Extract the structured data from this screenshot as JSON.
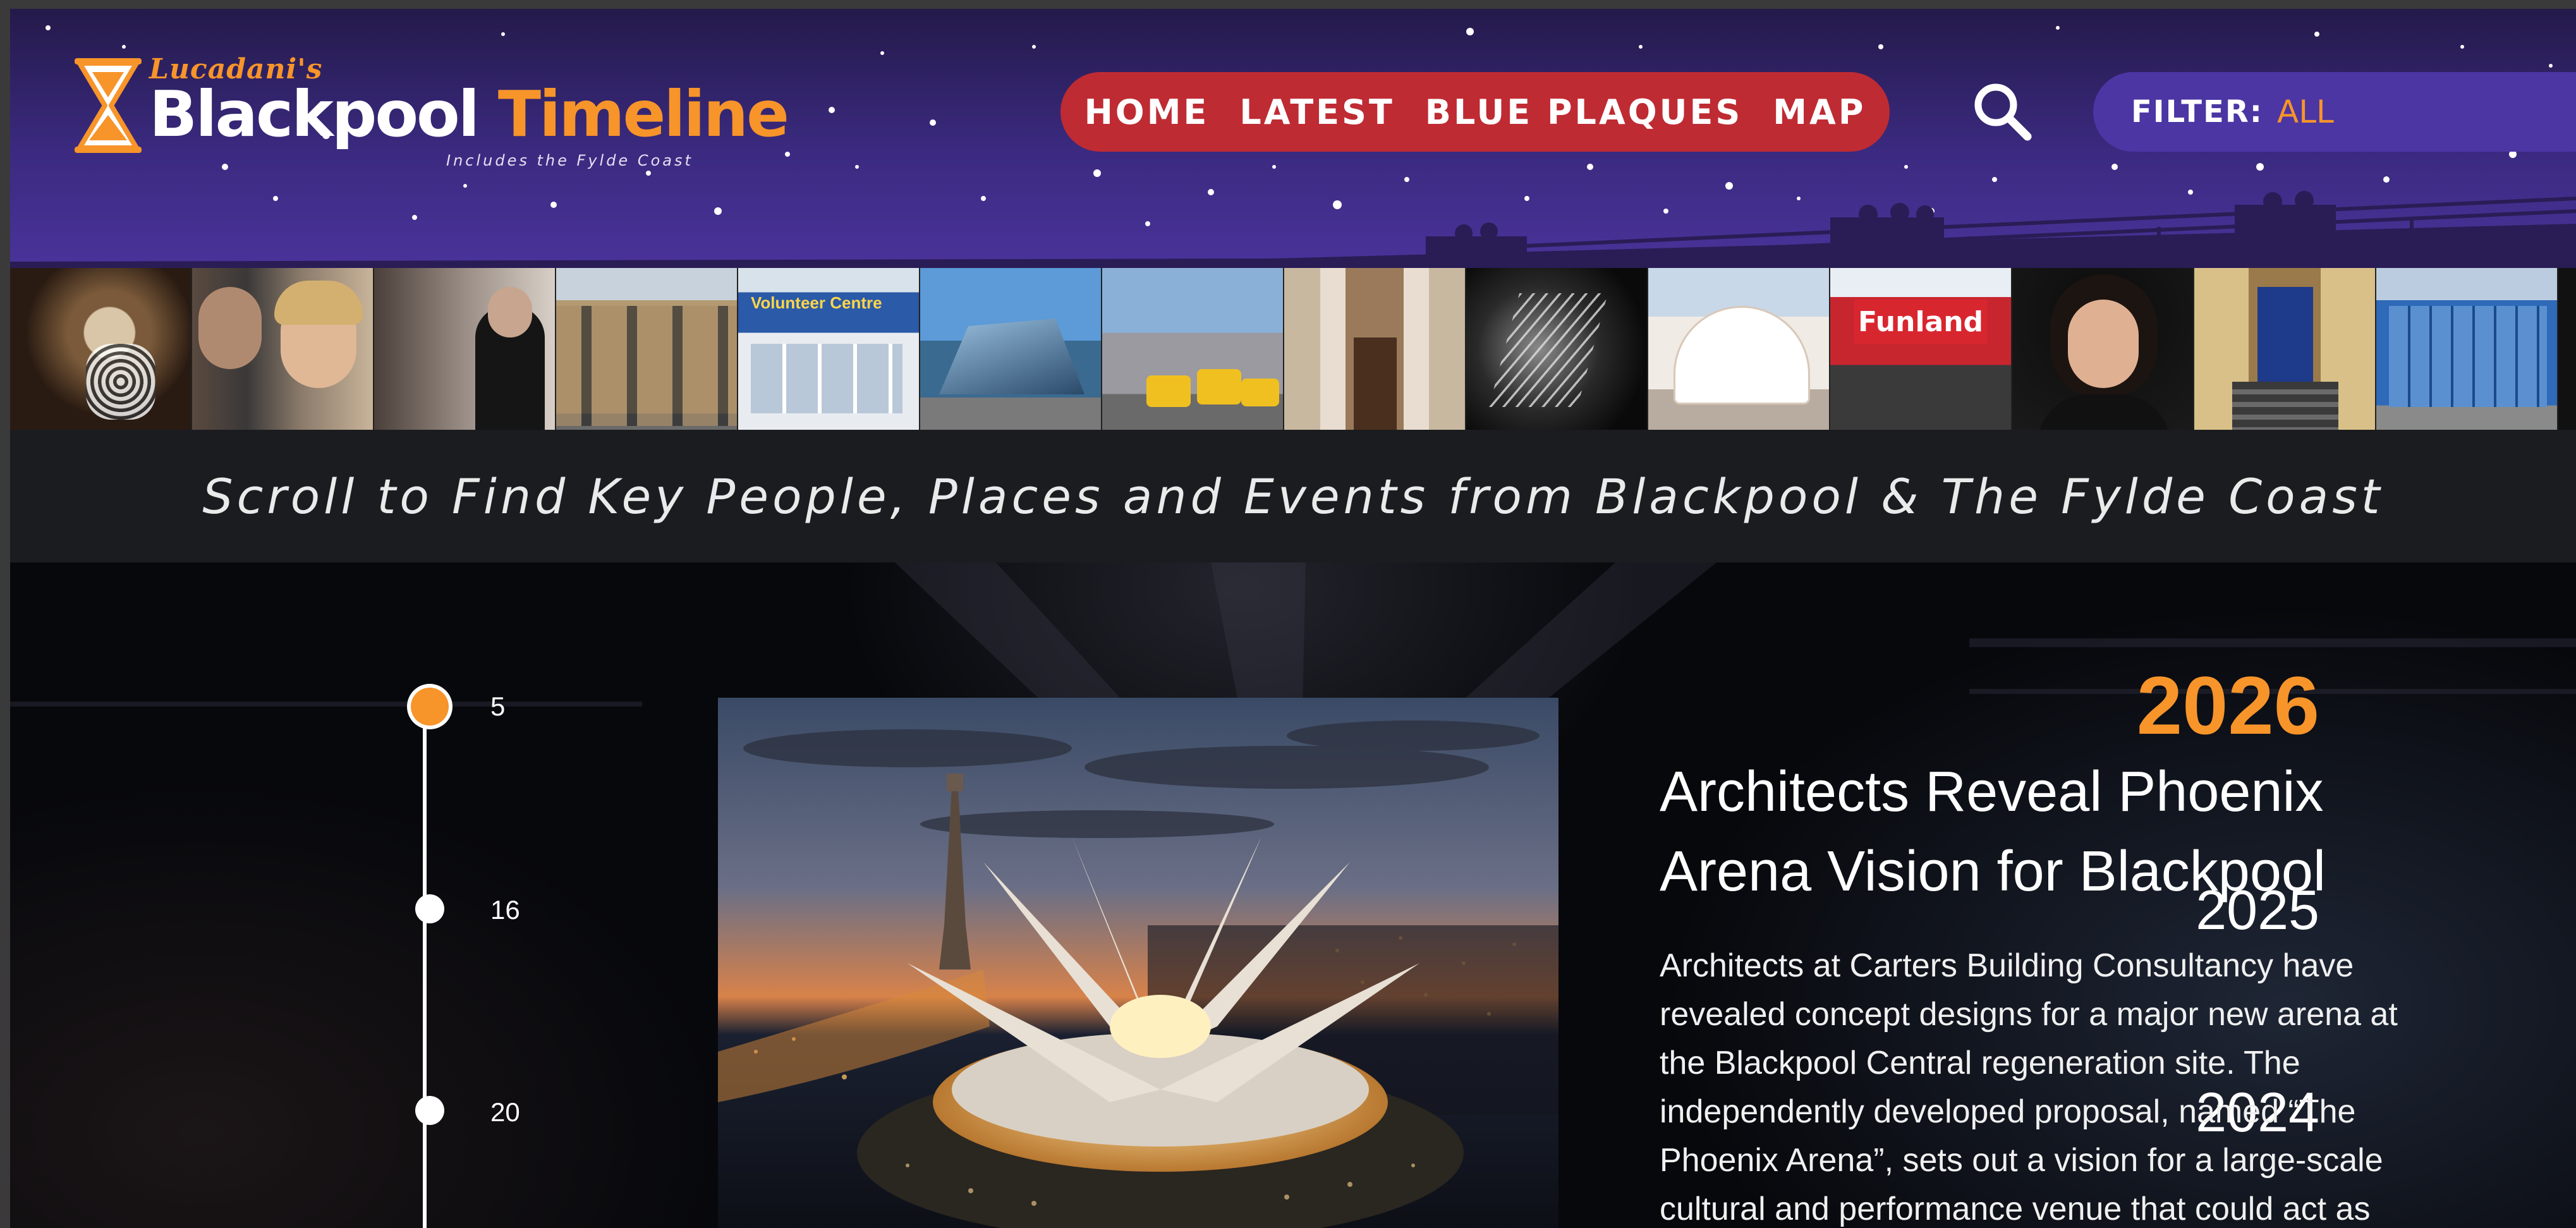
{
  "colors": {
    "accent_orange": "#f7942a",
    "nav_red": "#bf2b33",
    "header_purple": "#3b2a80",
    "filter_purple": "#4b36a4",
    "page_dark": "#07080c"
  },
  "logo": {
    "brand": "Lucadani's",
    "title_white": "Blackpool",
    "title_orange": "Timeline",
    "subtitle": "Includes the Fylde Coast",
    "icon": "hourglass-icon"
  },
  "nav": {
    "items": [
      {
        "label": "HOME"
      },
      {
        "label": "LATEST"
      },
      {
        "label": "BLUE PLAQUES"
      },
      {
        "label": "MAP"
      }
    ],
    "search_icon": "search-icon"
  },
  "filter": {
    "label": "FILTER:",
    "value": "ALL"
  },
  "strip": {
    "tiles": [
      {
        "subject": "portrait-vintage"
      },
      {
        "subject": "people-couple"
      },
      {
        "subject": "people-meeting"
      },
      {
        "subject": "victorian-terrace"
      },
      {
        "subject": "volunteer-centre",
        "sign": "Volunteer Centre"
      },
      {
        "subject": "glass-building"
      },
      {
        "subject": "station-vans"
      },
      {
        "subject": "stone-doorway"
      },
      {
        "subject": "tower-night"
      },
      {
        "subject": "white-pavilion"
      },
      {
        "subject": "funland",
        "sign": "Funland"
      },
      {
        "subject": "portrait-woman"
      },
      {
        "subject": "blue-door"
      },
      {
        "subject": "modern-blue-building"
      }
    ]
  },
  "tagline": "Scroll to Find Key People, Places and Events from Blackpool & The Fylde Coast",
  "timeline": {
    "years": [
      {
        "year": "2026",
        "count": "5",
        "active": true
      },
      {
        "year": "2025",
        "count": "16",
        "active": false
      },
      {
        "year": "2024",
        "count": "20",
        "active": false
      }
    ]
  },
  "article": {
    "title": "Architects Reveal Phoenix Arena Vision for Blackpool",
    "body": "Architects at Carters Building Consultancy have revealed concept designs for a major new arena at the Blackpool Central regeneration site. The independently developed proposal, named “The Phoenix Arena”, sets out a vision for a large-scale cultural and performance venue that could act as"
  }
}
